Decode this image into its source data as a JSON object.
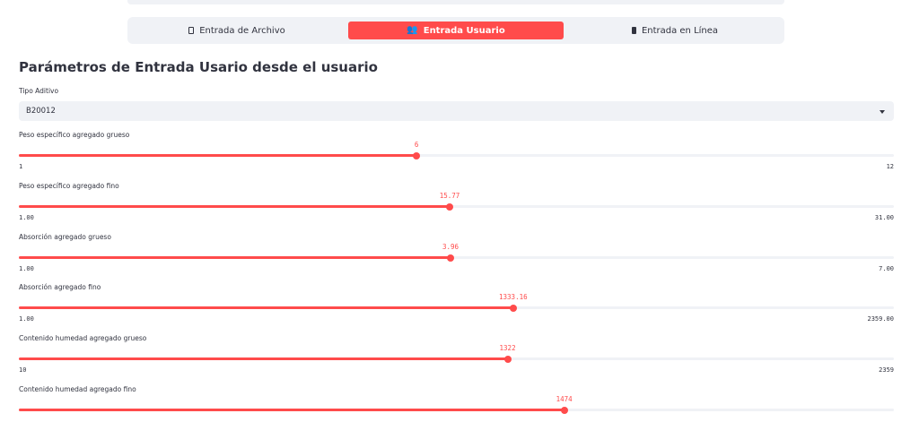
{
  "tabs": [
    {
      "label": "Entrada de Archivo",
      "icon": "document-icon",
      "active": false
    },
    {
      "label": "Entrada Usuario",
      "icon": "users-icon",
      "active": true
    },
    {
      "label": "Entrada en Línea",
      "icon": "phone-icon",
      "active": false
    }
  ],
  "accent_color": "#ff4b4b",
  "section_title": "Parámetros de Entrada Usario desde el usuario",
  "tipo_aditivo": {
    "label": "Tipo Aditivo",
    "value": "B20012"
  },
  "sliders": [
    {
      "label": "Peso específico agregado grueso",
      "value": 6,
      "value_text": "6",
      "min": 1,
      "max": 12,
      "min_text": "1",
      "max_text": "12"
    },
    {
      "label": "Peso específico agregado fino",
      "value": 15.77,
      "value_text": "15.77",
      "min": 1,
      "max": 31,
      "min_text": "1.00",
      "max_text": "31.00"
    },
    {
      "label": "Absorción agregado grueso",
      "value": 3.96,
      "value_text": "3.96",
      "min": 1,
      "max": 7,
      "min_text": "1.00",
      "max_text": "7.00"
    },
    {
      "label": "Absorción agregado fino",
      "value": 1333.16,
      "value_text": "1333.16",
      "min": 1,
      "max": 2359,
      "min_text": "1.00",
      "max_text": "2359.00"
    },
    {
      "label": "Contenido humedad agregado grueso",
      "value": 1322,
      "value_text": "1322",
      "min": 10,
      "max": 2359,
      "min_text": "10",
      "max_text": "2359"
    },
    {
      "label": "Contenido humedad agregado fino",
      "value": 1474,
      "value_text": "1474",
      "min": 10,
      "max": 2359,
      "min_text": "",
      "max_text": ""
    }
  ]
}
